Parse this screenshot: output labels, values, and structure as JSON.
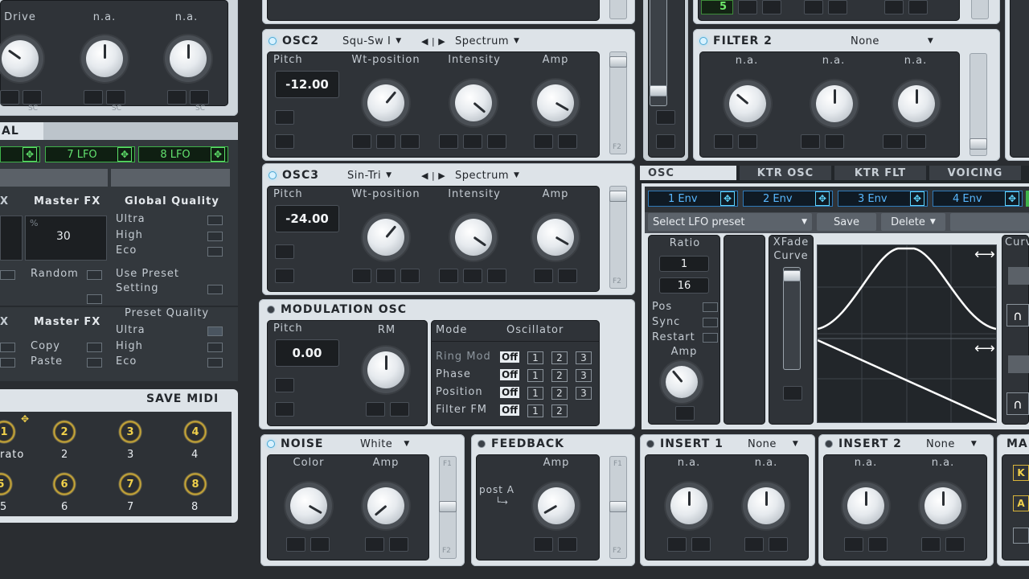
{
  "top_left_panel": {
    "labels": [
      "Drive",
      "n.a.",
      "n.a."
    ],
    "sc": "SC"
  },
  "left_panel": {
    "tab_label": "AL",
    "lfo_buttons": [
      "7 LFO",
      "8 LFO"
    ],
    "master_fx_1": "Master FX",
    "master_fx_2": "Master FX",
    "fx_left_1": "X",
    "fx_left_2": "X",
    "global_quality": {
      "title": "Global Quality",
      "options": [
        "Ultra",
        "High",
        "Eco"
      ]
    },
    "percent_symbol": "%",
    "percent_value": "30",
    "random_label": "Random",
    "use_preset": [
      "Use Preset",
      "Setting"
    ],
    "preset_quality": {
      "title": "Preset Quality",
      "options": [
        "Ultra",
        "High",
        "Eco"
      ]
    },
    "copy_label": "Copy",
    "paste_label": "Paste",
    "save_midi": "SAVE MIDI",
    "macros_row1": [
      "1",
      "2",
      "3",
      "4"
    ],
    "macros_row1_labels": [
      "rato",
      "2",
      "3",
      "4"
    ],
    "macros_row2": [
      "5",
      "6",
      "7",
      "8"
    ],
    "macros_row2_labels": [
      "5",
      "6",
      "7",
      "8"
    ]
  },
  "osc2": {
    "title": "OSC2",
    "wave": "Squ-Sw I",
    "mode": "Spectrum",
    "labels": [
      "Pitch",
      "Wt-position",
      "Intensity",
      "Amp"
    ],
    "pitch": "-12.00"
  },
  "osc3": {
    "title": "OSC3",
    "wave": "Sin-Tri",
    "mode": "Spectrum",
    "labels": [
      "Pitch",
      "Wt-position",
      "Intensity",
      "Amp"
    ],
    "pitch": "-24.00"
  },
  "mod_osc": {
    "title": "MODULATION OSC",
    "pitch_label": "Pitch",
    "rm_label": "RM",
    "pitch": "0.00",
    "mode_header": "Mode",
    "osc_header": "Oscillator",
    "modes": [
      "Ring Mod",
      "Phase",
      "Position",
      "Filter FM"
    ],
    "off_label": "Off",
    "nums": [
      "1",
      "2",
      "3"
    ]
  },
  "noise": {
    "title": "NOISE",
    "type": "White",
    "labels": [
      "Color",
      "Amp"
    ]
  },
  "feedback": {
    "title": "FEEDBACK",
    "amp_label": "Amp",
    "post": "post A"
  },
  "filter_top": {
    "value": "5"
  },
  "filter2": {
    "title": "FILTER 2",
    "type": "None",
    "labels": [
      "n.a.",
      "n.a.",
      "n.a."
    ]
  },
  "right_tabs": [
    "OSC",
    "KTR OSC",
    "KTR FLT",
    "VOICING"
  ],
  "env_buttons": [
    "1 Env",
    "2 Env",
    "3 Env",
    "4 Env"
  ],
  "lfo": {
    "preset": "Select LFO preset",
    "save": "Save",
    "delete": "Delete",
    "ratio_label": "Ratio",
    "ratio_values": [
      "1",
      "16"
    ],
    "xfade": [
      "XFade",
      "Curve"
    ],
    "toggles": [
      "Pos",
      "Sync",
      "Restart"
    ],
    "amp_label": "Amp",
    "curve_label": "Curv"
  },
  "insert1": {
    "title": "INSERT 1",
    "type": "None",
    "labels": [
      "n.a.",
      "n.a."
    ]
  },
  "insert2": {
    "title": "INSERT 2",
    "type": "None",
    "labels": [
      "n.a.",
      "n.a."
    ]
  },
  "far_right": {
    "title": "MA",
    "btn1": "K",
    "btn2": "A"
  },
  "slider_labels": {
    "f1": "F1",
    "f2": "F2"
  }
}
